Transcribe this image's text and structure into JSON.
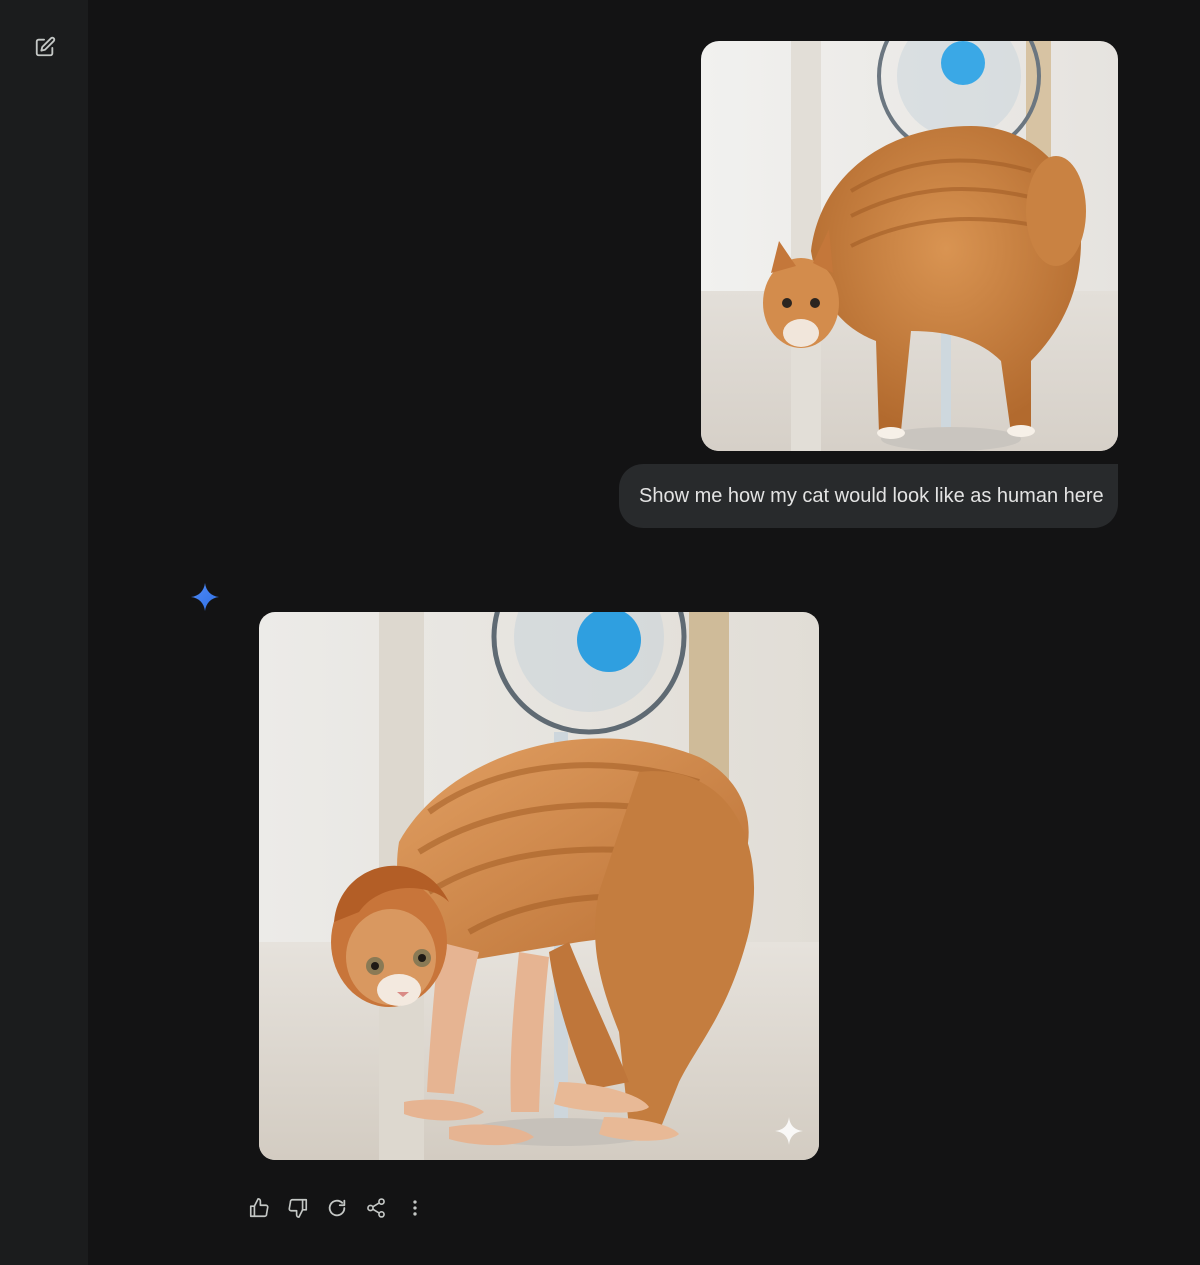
{
  "sidebar": {
    "new_chat_icon": "edit-square-icon"
  },
  "conversation": {
    "user_turn": {
      "image_subject": "orange tabby cat arching its back next to a blue desk fan",
      "prompt_text": "Show me how my cat would look like as human here"
    },
    "model_turn": {
      "avatar_icon": "gemini-spark-icon",
      "image_subject": "human figure in orange tabby striped outfit with a cat face, bent over on all fours",
      "watermark_icon": "sparkle-watermark-icon"
    },
    "actions": [
      {
        "name": "thumbs-up",
        "icon": "thumbs-up-icon"
      },
      {
        "name": "thumbs-down",
        "icon": "thumbs-down-icon"
      },
      {
        "name": "regenerate",
        "icon": "refresh-icon"
      },
      {
        "name": "share",
        "icon": "share-icon"
      },
      {
        "name": "more",
        "icon": "more-vert-icon"
      }
    ]
  },
  "colors": {
    "background": "#131314",
    "sidebar": "#1b1c1d",
    "user_bubble": "#282a2c",
    "icon": "#c4c7c5",
    "gemini_blue": "#4285f4"
  }
}
